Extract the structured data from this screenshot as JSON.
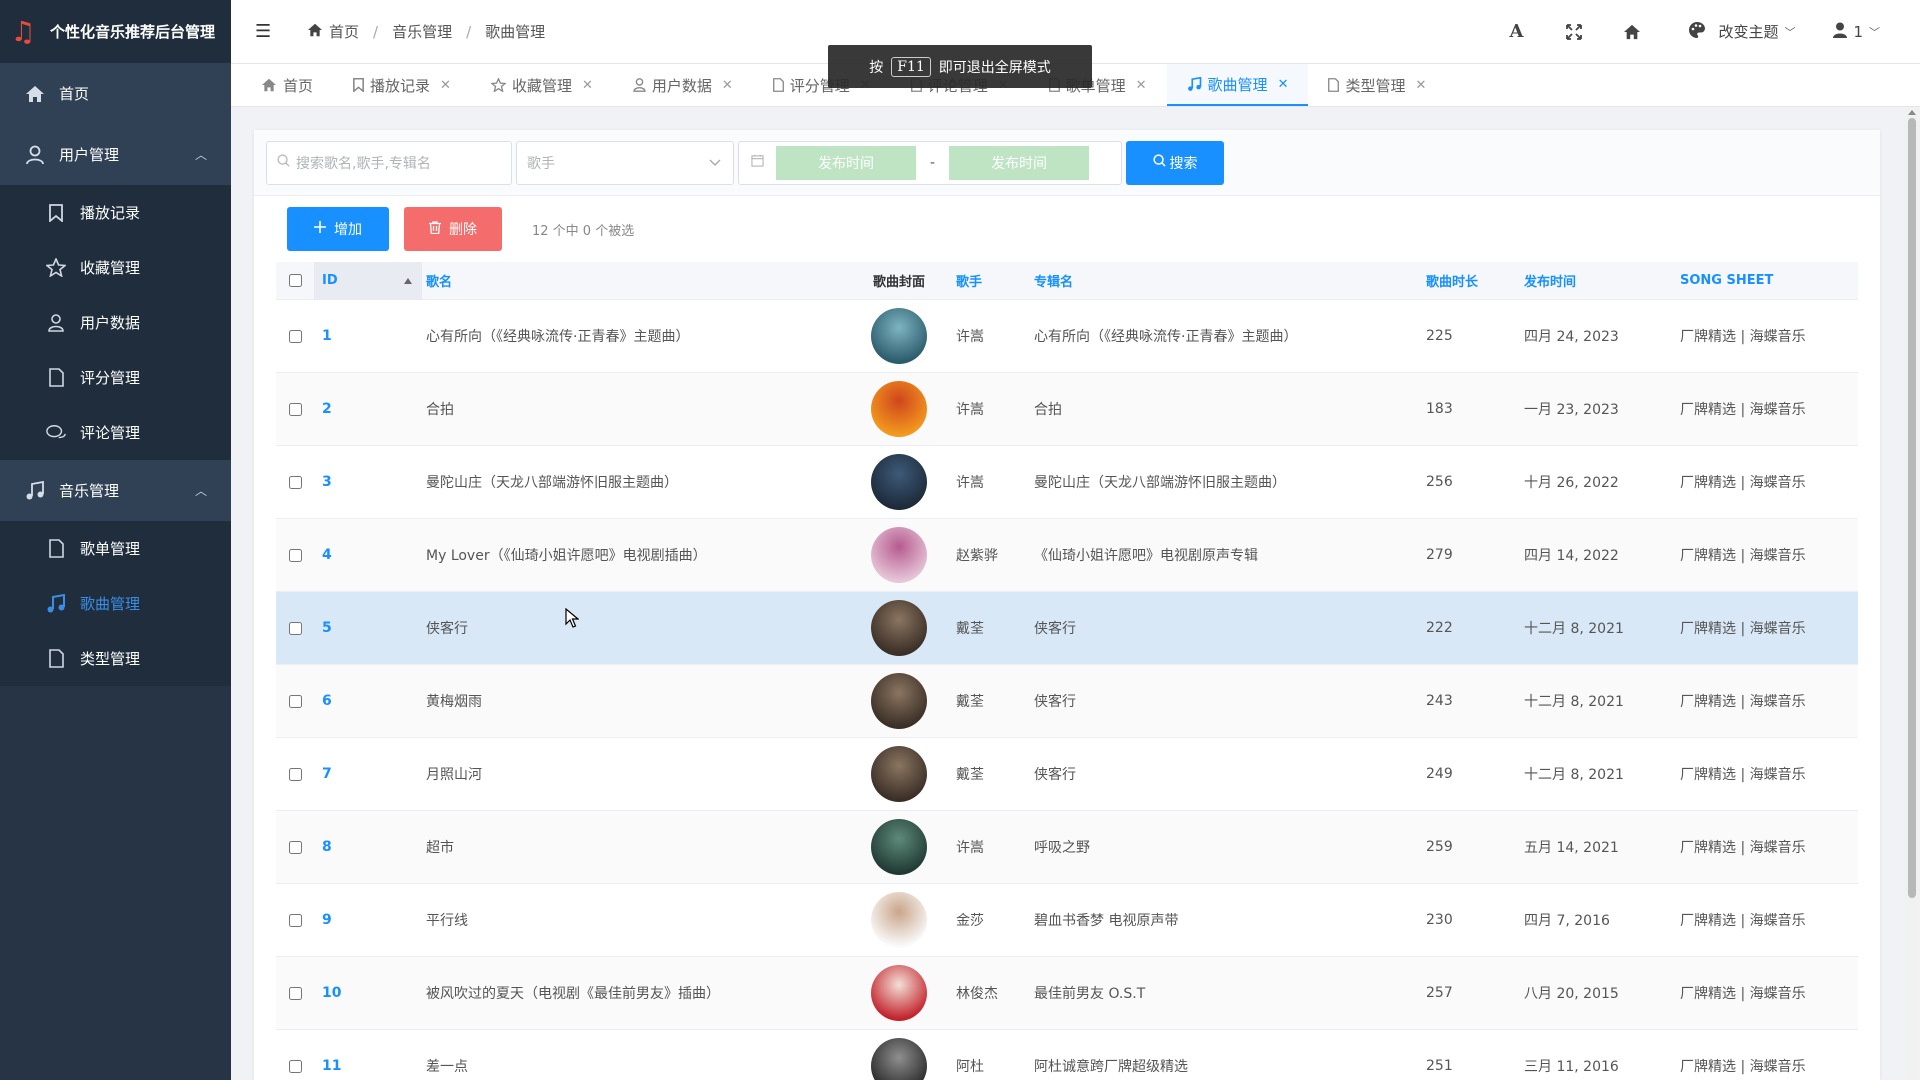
{
  "brand": {
    "title": "个性化音乐推荐后台管理"
  },
  "sidebar": {
    "home": "首页",
    "user_mgmt": "用户管理",
    "user_items": [
      {
        "label": "播放记录",
        "icon": "bookmark-icon"
      },
      {
        "label": "收藏管理",
        "icon": "star-icon"
      },
      {
        "label": "用户数据",
        "icon": "user-icon"
      },
      {
        "label": "评分管理",
        "icon": "file-icon"
      },
      {
        "label": "评论管理",
        "icon": "comment-icon"
      }
    ],
    "music_mgmt": "音乐管理",
    "music_items": [
      {
        "label": "歌单管理",
        "icon": "file-icon"
      },
      {
        "label": "歌曲管理",
        "icon": "music-icon",
        "active": true
      },
      {
        "label": "类型管理",
        "icon": "file-icon"
      }
    ]
  },
  "breadcrumb": [
    "首页",
    "音乐管理",
    "歌曲管理"
  ],
  "topbar": {
    "theme": "改变主题",
    "user": "1"
  },
  "fullscreen_tip": {
    "prefix": "按",
    "key": "F11",
    "suffix": "即可退出全屏模式"
  },
  "tabs": [
    {
      "label": "首页",
      "closable": false
    },
    {
      "label": "播放记录",
      "closable": true
    },
    {
      "label": "收藏管理",
      "closable": true
    },
    {
      "label": "用户数据",
      "closable": true
    },
    {
      "label": "评分管理",
      "closable": true
    },
    {
      "label": "评论管理",
      "closable": true
    },
    {
      "label": "歌单管理",
      "closable": true
    },
    {
      "label": "歌曲管理",
      "closable": true,
      "active": true
    },
    {
      "label": "类型管理",
      "closable": true
    }
  ],
  "search": {
    "keyword_placeholder": "搜索歌名,歌手,专辑名",
    "singer_placeholder": "歌手",
    "date_start": "发布时间",
    "date_end": "发布时间",
    "date_sep": "-",
    "button": "搜索"
  },
  "actions": {
    "add": "增加",
    "delete": "删除",
    "selection": "12 个中 0 个被选"
  },
  "table": {
    "headers": {
      "id": "ID",
      "name": "歌名",
      "cover": "歌曲封面",
      "singer": "歌手",
      "album": "专辑名",
      "length": "歌曲时长",
      "date": "发布时间",
      "sheet": "SONG SHEET"
    },
    "rows": [
      {
        "id": "1",
        "name": "心有所向（《经典咏流传·正青春》主题曲）",
        "singer": "许嵩",
        "album": "心有所向（《经典咏流传·正青春》主题曲）",
        "length": "225",
        "date": "四月 24, 2023",
        "sheet": "厂牌精选 | 海蝶音乐",
        "cover": [
          "#2b5c6b",
          "#7fb4c2"
        ]
      },
      {
        "id": "2",
        "name": "合拍",
        "singer": "许嵩",
        "album": "合拍",
        "length": "183",
        "date": "一月 23, 2023",
        "sheet": "厂牌精选 | 海蝶音乐",
        "cover": [
          "#f39a1f",
          "#d0451c"
        ]
      },
      {
        "id": "3",
        "name": "曼陀山庄（天龙八部端游怀旧服主题曲）",
        "singer": "许嵩",
        "album": "曼陀山庄（天龙八部端游怀旧服主题曲）",
        "length": "256",
        "date": "十月 26, 2022",
        "sheet": "厂牌精选 | 海蝶音乐",
        "cover": [
          "#1d2a3a",
          "#3d5a78"
        ]
      },
      {
        "id": "4",
        "name": "My Lover（《仙琦小姐许愿吧》电视剧插曲）",
        "singer": "赵紫骅",
        "album": "《仙琦小姐许愿吧》电视剧原声专辑",
        "length": "279",
        "date": "四月 14, 2022",
        "sheet": "厂牌精选 | 海蝶音乐",
        "cover": [
          "#e6c6d8",
          "#b65b8f"
        ]
      },
      {
        "id": "5",
        "name": "侠客行",
        "singer": "戴荃",
        "album": "侠客行",
        "length": "222",
        "date": "十二月 8, 2021",
        "sheet": "厂牌精选 | 海蝶音乐",
        "cover": [
          "#3a2e26",
          "#8a7560"
        ]
      },
      {
        "id": "6",
        "name": "黄梅烟雨",
        "singer": "戴荃",
        "album": "侠客行",
        "length": "243",
        "date": "十二月 8, 2021",
        "sheet": "厂牌精选 | 海蝶音乐",
        "cover": [
          "#3a2e26",
          "#8a7560"
        ]
      },
      {
        "id": "7",
        "name": "月照山河",
        "singer": "戴荃",
        "album": "侠客行",
        "length": "249",
        "date": "十二月 8, 2021",
        "sheet": "厂牌精选 | 海蝶音乐",
        "cover": [
          "#3a2e26",
          "#8a7560"
        ]
      },
      {
        "id": "8",
        "name": "超市",
        "singer": "许嵩",
        "album": "呼吸之野",
        "length": "259",
        "date": "五月 14, 2021",
        "sheet": "厂牌精选 | 海蝶音乐",
        "cover": [
          "#203a33",
          "#5e8a7a"
        ]
      },
      {
        "id": "9",
        "name": "平行线",
        "singer": "金莎",
        "album": "碧血书香梦 电视原声带",
        "length": "230",
        "date": "四月 7, 2016",
        "sheet": "厂牌精选 | 海蝶音乐",
        "cover": [
          "#fafafa",
          "#c9a58a"
        ]
      },
      {
        "id": "10",
        "name": "被风吹过的夏天（电视剧《最佳前男友》插曲）",
        "singer": "林俊杰",
        "album": "最佳前男友 O.S.T",
        "length": "257",
        "date": "八月 20, 2015",
        "sheet": "厂牌精选 | 海蝶音乐",
        "cover": [
          "#c2222b",
          "#f3e0d7"
        ]
      },
      {
        "id": "11",
        "name": "差一点",
        "singer": "阿杜",
        "album": "阿杜诚意跨厂牌超级精选",
        "length": "251",
        "date": "三月 11, 2016",
        "sheet": "厂牌精选 | 海蝶音乐",
        "cover": [
          "#2a2a2a",
          "#8f8f8f"
        ]
      }
    ]
  }
}
